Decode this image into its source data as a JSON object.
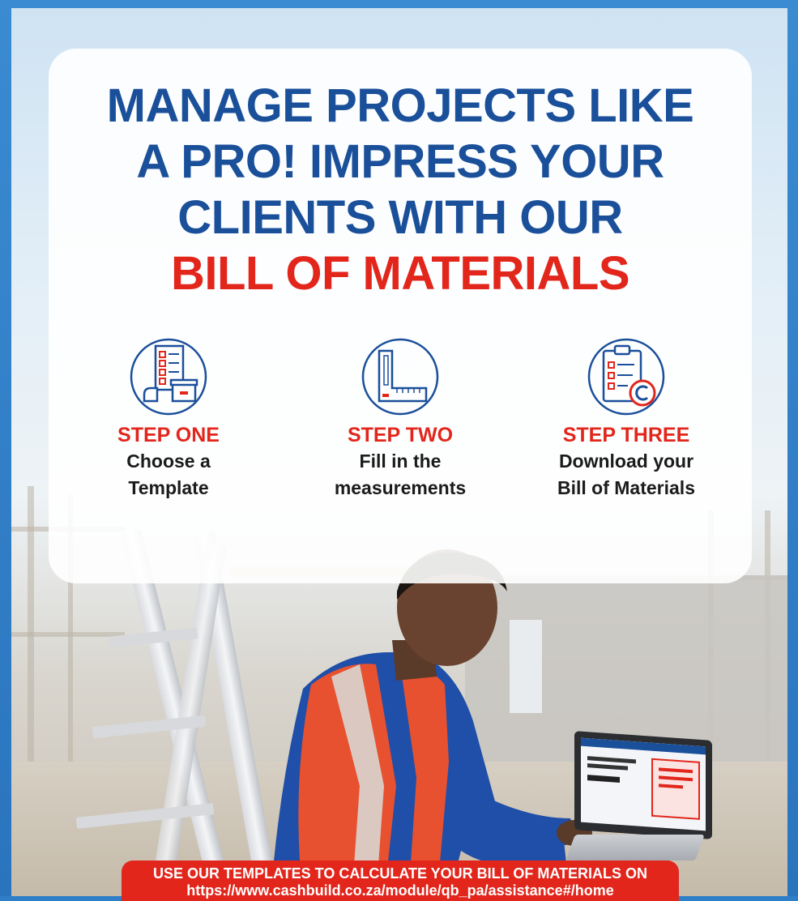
{
  "headline": {
    "line1": "MANAGE PROJECTS LIKE",
    "line2": "A PRO! IMPRESS YOUR",
    "line3": "CLIENTS WITH OUR",
    "line4": "BILL OF MATERIALS"
  },
  "steps": [
    {
      "title": "STEP ONE",
      "desc_line1": "Choose a",
      "desc_line2": "Template",
      "icon": "template-icon"
    },
    {
      "title": "STEP TWO",
      "desc_line1": "Fill in the",
      "desc_line2": "measurements",
      "icon": "ruler-square-icon"
    },
    {
      "title": "STEP THREE",
      "desc_line1": "Download your",
      "desc_line2": "Bill of Materials",
      "icon": "clipboard-checklist-icon"
    }
  ],
  "banner": {
    "line1": "USE OUR TEMPLATES TO CALCULATE YOUR BILL OF MATERIALS ON",
    "line2": "https://www.cashbuild.co.za/module/qb_pa/assistance#/home"
  },
  "colors": {
    "navy": "#1a4f9a",
    "red": "#e2261c",
    "frame_blue": "#2f7fc8"
  }
}
